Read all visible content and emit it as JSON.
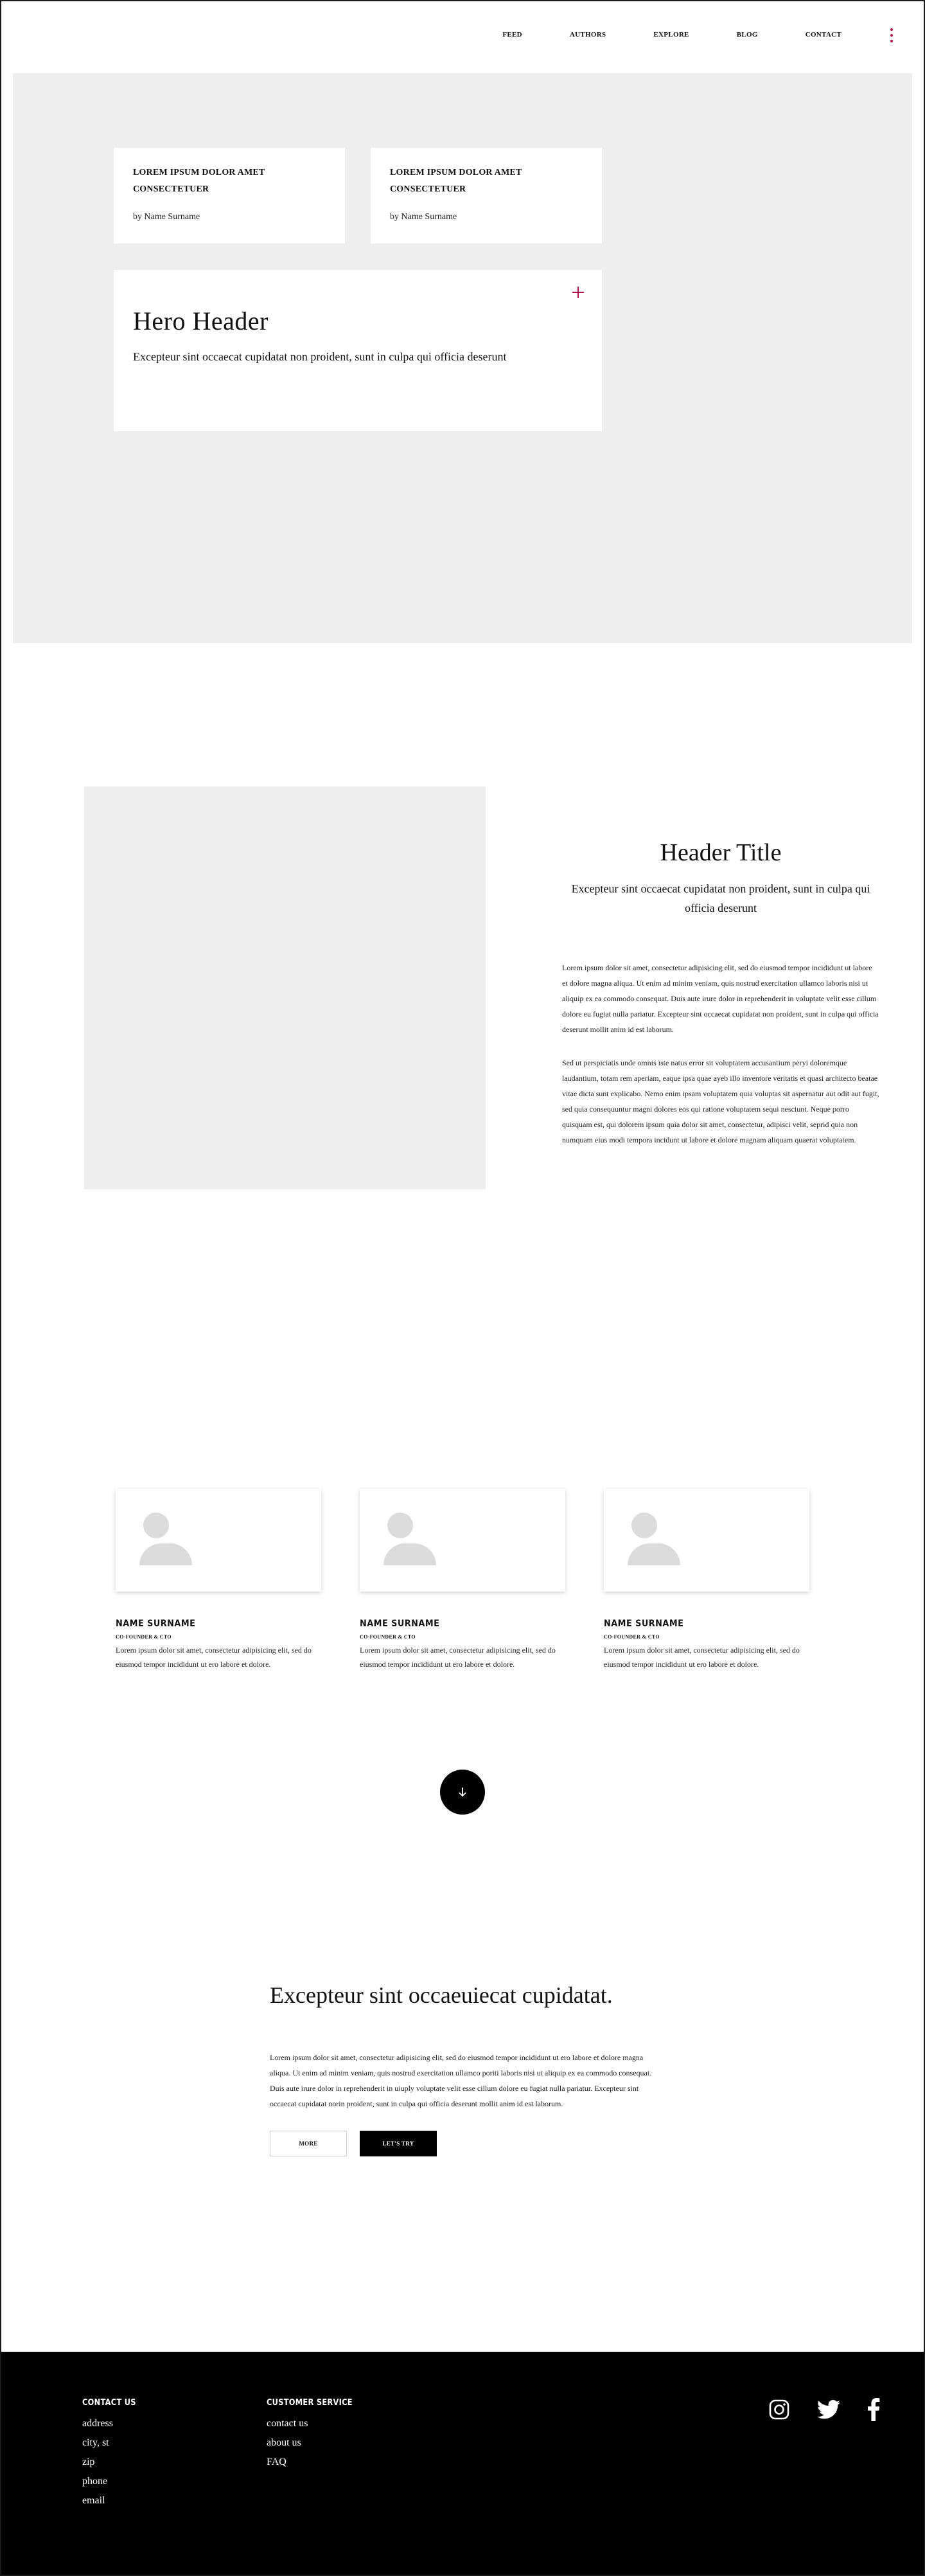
{
  "nav": {
    "links": [
      "FEED",
      "AUTHORS",
      "EXPLORE",
      "BLOG",
      "CONTACT"
    ]
  },
  "hero": {
    "cards": [
      {
        "title": "LOREM IPSUM DOLOR AMET CONSECTETUER",
        "byline": "by Name Surname"
      },
      {
        "title": "LOREM IPSUM DOLOR AMET CONSECTETUER",
        "byline": "by Name Surname"
      }
    ],
    "header": "Hero Header",
    "subtext": "Excepteur sint occaecat cupidatat non proident, sunt in culpa qui officia deserunt"
  },
  "feature": {
    "title": "Header Title",
    "subtitle": "Excepteur sint occaecat cupidatat non proident, sunt in culpa qui officia deserunt",
    "paragraph1": "Lorem ipsum dolor sit amet, consectetur adipisicing elit, sed do eiusmod tempor incididunt ut labore et dolore magna aliqua. Ut enim ad minim veniam, quis nostrud exercitation ullamco laboris nisi ut aliquip ex ea commodo consequat. Duis aute irure dolor in reprehenderit in voluptate velit esse cillum dolore eu fugiat nulla pariatur. Excepteur sint occaecat cupidatat non proident, sunt in culpa qui officia deserunt mollit anim id est laborum.",
    "paragraph2": "Sed ut perspiciatis unde omnis iste natus error sit voluptatem accusantium peryi doloremque laudantium, totam rem aperiam, eaque ipsa quae ayeb illo inventore veritatis et quasi architecto beatae vitae dicta sunt explicabo. Nemo enim ipsam voluptatem quia voluptas sit aspernatur aut odit aut fugit, sed quia consequuntur magni dolores eos qui ratione voluptatem sequi nesciunt. Neque porro quisquam est, qui dolorem ipsum quia dolor sit amet, consectetur, adipisci velit, seprid quia non numquam eius modi tempora incidunt ut labore et dolore magnam aliquam quaerat voluptatem."
  },
  "team": [
    {
      "name": "NAME SURNAME",
      "role": "CO-FOUNDER & CTO",
      "bio": "Lorem ipsum dolor sit amet, consectetur adipisicing elit, sed do eiusmod tempor incididunt ut ero labore et dolore."
    },
    {
      "name": "NAME SURNAME",
      "role": "CO-FOUNDER & CTO",
      "bio": "Lorem ipsum dolor sit amet, consectetur adipisicing elit, sed do eiusmod tempor incididunt ut ero labore et dolore."
    },
    {
      "name": "NAME SURNAME",
      "role": "CO-FOUNDER & CTO",
      "bio": "Lorem ipsum dolor sit amet, consectetur adipisicing elit, sed do eiusmod tempor incididunt ut ero labore et dolore."
    }
  ],
  "cta": {
    "title": "Excepteur sint occaeuiecat cupidatat.",
    "text": "Lorem ipsum dolor sit amet, consectetur adipisicing elit, sed do eiusmod tempor incididunt ut ero labore et dolore magna aliqua. Ut enim ad minim veniam, quis nostrud exercitation ullamco poriti laboris nisi ut aliquip ex ea commodo consequat. Duis aute irure dolor in reprehenderit in uiuply voluptate velit esse cillum dolore eu fugiat nulla pariatur. Excepteur sint occaecat cupidatat norin proident, sunt in culpa qui officia deserunt mollit anim id est laborum.",
    "button_more": "MORE",
    "button_try": "LET'S TRY"
  },
  "footer": {
    "contact_heading": "CONTACT US",
    "contact_links": [
      "address",
      "city, st",
      "zip",
      "phone",
      "email"
    ],
    "service_heading": "CUSTOMER SERVICE",
    "service_links": [
      "contact us",
      "about us",
      "FAQ"
    ]
  },
  "icons": {
    "nav_more": "more-vertical-icon",
    "hero_plus": "plus-icon",
    "scroll": "arrow-down-icon",
    "avatar": "user-placeholder-icon",
    "socials": [
      "instagram-icon",
      "twitter-icon",
      "facebook-icon"
    ]
  },
  "colors": {
    "accent": "#b0124b",
    "hero_bg": "#eeeeee",
    "footer_bg": "#000000"
  }
}
